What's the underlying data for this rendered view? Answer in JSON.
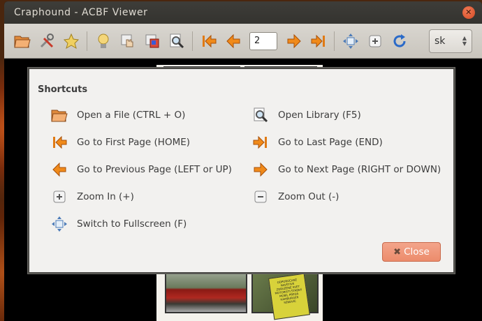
{
  "window": {
    "title": "Craphound - ACBF Viewer"
  },
  "toolbar": {
    "page_value": "2",
    "language_value": "sk",
    "buttons": [
      "open-file",
      "preferences",
      "bookmark",
      "info",
      "hand",
      "color",
      "zoom-library",
      "first-page",
      "previous-page",
      "next-page",
      "last-page",
      "fullscreen",
      "zoom-in",
      "refresh"
    ]
  },
  "comic": {
    "sign_text": "ODPORÚČANÉ NAVŠTIVE ZDRUŽENÉ SVET MOTORISTI ŠTÁBNÝ MOBIL PREDÁ HAMBURGER SENDVIČ"
  },
  "dialog": {
    "title": "Shortcuts",
    "left": [
      {
        "label": "Open a File (CTRL + O)",
        "icon": "open-file-icon"
      },
      {
        "label": "Go to First Page (HOME)",
        "icon": "first-page-icon"
      },
      {
        "label": "Go to Previous Page (LEFT or UP)",
        "icon": "previous-page-icon"
      },
      {
        "label": "Zoom In (+)",
        "icon": "zoom-in-icon"
      },
      {
        "label": "Switch to Fullscreen (F)",
        "icon": "fullscreen-icon"
      }
    ],
    "right": [
      {
        "label": "Open Library (F5)",
        "icon": "library-icon"
      },
      {
        "label": "Go to Last Page (END)",
        "icon": "last-page-icon"
      },
      {
        "label": "Go to Next Page (RIGHT or DOWN)",
        "icon": "next-page-icon"
      },
      {
        "label": "Zoom Out (-)",
        "icon": "zoom-out-icon"
      }
    ],
    "close_label": "Close"
  },
  "colors": {
    "accent": "#ec8c6c",
    "arrow_orange": "#f08a1a"
  }
}
